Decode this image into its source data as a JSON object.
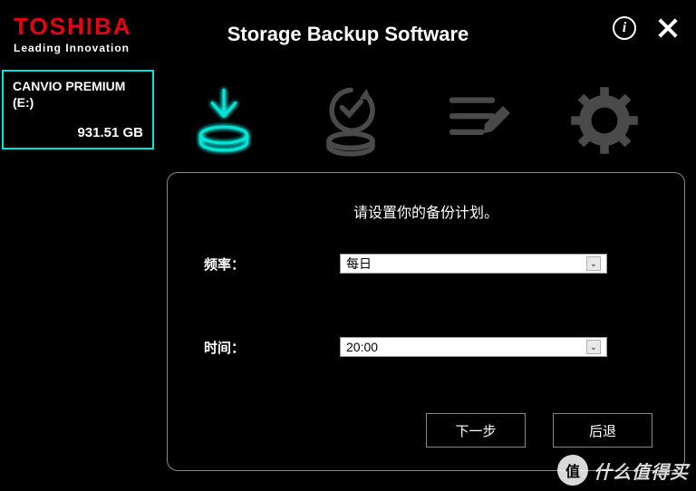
{
  "brand": {
    "name": "TOSHIBA",
    "tagline": "Leading Innovation"
  },
  "app_title": "Storage Backup Software",
  "device": {
    "name": "CANVIO PREMIUM",
    "letter": "(E:)",
    "size": "931.51 GB"
  },
  "panel": {
    "title": "请设置你的备份计划。",
    "frequency_label": "频率：",
    "frequency_value": "每日",
    "time_label": "时间：",
    "time_value": "20:00",
    "next_button": "下一步",
    "back_button": "后退"
  },
  "info_glyph": "i",
  "watermark": {
    "circle": "值",
    "text": "什么值得买"
  },
  "colors": {
    "accent": "#00e5d8",
    "brand_red": "#e60012"
  }
}
